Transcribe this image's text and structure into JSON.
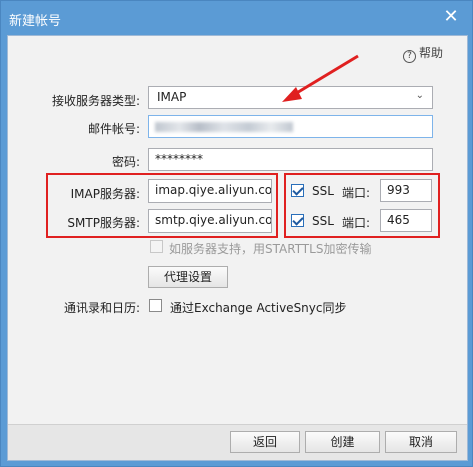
{
  "window": {
    "title": "新建帐号",
    "close_glyph": "✕"
  },
  "help": {
    "label": "帮助"
  },
  "form": {
    "server_type": {
      "label": "接收服务器类型:",
      "value": "IMAP"
    },
    "account": {
      "label": "邮件帐号:"
    },
    "password": {
      "label": "密码:",
      "value": "********"
    },
    "imap": {
      "label": "IMAP服务器:",
      "value": "imap.qiye.aliyun.cor",
      "ssl_label": "SSL",
      "ssl_checked": true,
      "port_label": "端口:",
      "port_value": "993"
    },
    "smtp": {
      "label": "SMTP服务器:",
      "value": "smtp.qiye.aliyun.cor",
      "ssl_label": "SSL",
      "ssl_checked": true,
      "port_label": "端口:",
      "port_value": "465"
    },
    "starttls_label": "如服务器支持，用STARTTLS加密传输",
    "proxy_button": "代理设置",
    "sync": {
      "label": "通讯录和日历:",
      "option_label": "通过Exchange ActiveSnyc同步"
    }
  },
  "footer": {
    "back_button": "返回",
    "create_button": "创建",
    "cancel_button": "取消"
  },
  "colors": {
    "titlebar": "#5b9bd5",
    "annotation_red": "#e02020"
  }
}
